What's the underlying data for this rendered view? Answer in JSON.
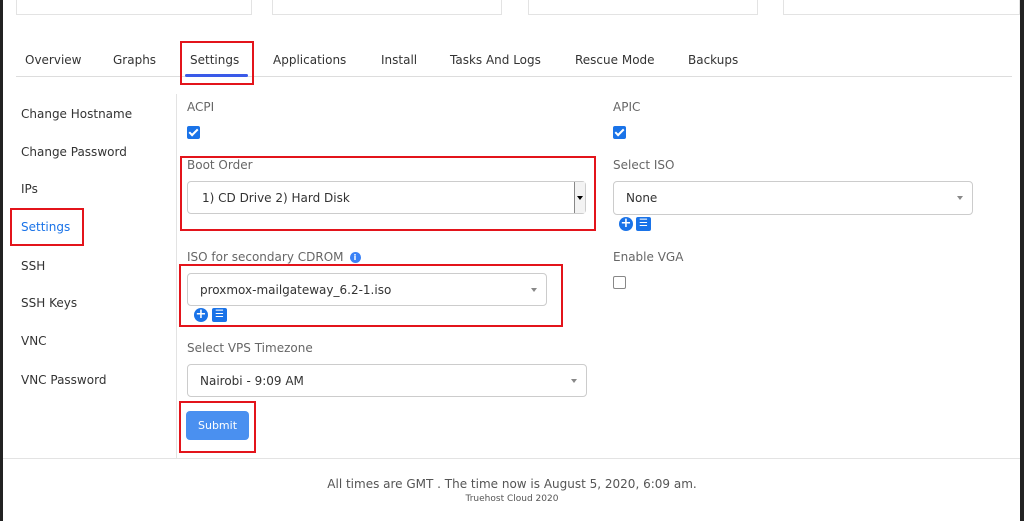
{
  "tabs": [
    "Overview",
    "Graphs",
    "Settings",
    "Applications",
    "Install",
    "Tasks And Logs",
    "Rescue Mode",
    "Backups"
  ],
  "sidebar": [
    "Change Hostname",
    "Change Password",
    "IPs",
    "Settings",
    "SSH",
    "SSH Keys",
    "VNC",
    "VNC Password"
  ],
  "form": {
    "acpi_label": "ACPI",
    "apic_label": "APIC",
    "boot_order_label": "Boot Order",
    "boot_order_value": "1) CD Drive 2) Hard Disk",
    "select_iso_label": "Select ISO",
    "select_iso_value": "None",
    "secondary_cdrom_label": "ISO for secondary CDROM",
    "secondary_cdrom_value": "proxmox-mailgateway_6.2-1.iso",
    "enable_vga_label": "Enable VGA",
    "timezone_label": "Select VPS Timezone",
    "timezone_value": "Nairobi - 9:09 AM",
    "submit_label": "Submit",
    "acpi_checked": true,
    "apic_checked": true,
    "vga_checked": false
  },
  "footer": {
    "time_text": "All times are GMT . The time now is August 5, 2020, 6:09 am.",
    "copyright": "Truehost Cloud 2020"
  },
  "colors": {
    "accent": "#1a73e8",
    "highlight": "#e3141b"
  }
}
